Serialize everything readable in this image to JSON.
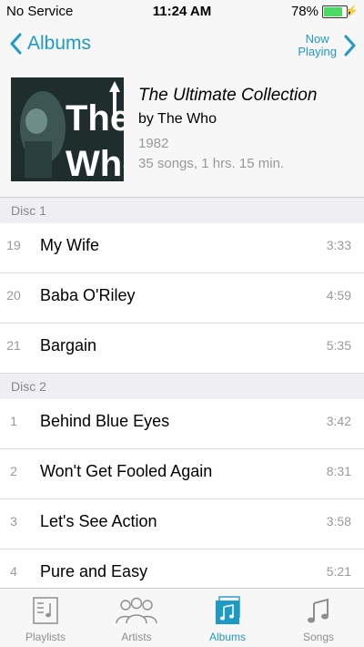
{
  "status": {
    "carrier": "No Service",
    "time": "11:24 AM",
    "battery": "78%",
    "battery_level": 0.78
  },
  "nav": {
    "back_label": "Albums",
    "now_playing": [
      "Now",
      "Playing"
    ]
  },
  "album": {
    "title": "The Ultimate Collection",
    "artist": "by The Who",
    "year": "1982",
    "info": "35 songs, 1 hrs. 15 min.",
    "cover_text": "The Who"
  },
  "discs": [
    {
      "label": "Disc 1",
      "tracks": [
        {
          "num": "19",
          "name": "My Wife",
          "duration": "3:33"
        },
        {
          "num": "20",
          "name": "Baba O'Riley",
          "duration": "4:59"
        },
        {
          "num": "21",
          "name": "Bargain",
          "duration": "5:35"
        }
      ]
    },
    {
      "label": "Disc 2",
      "tracks": [
        {
          "num": "1",
          "name": "Behind Blue Eyes",
          "duration": "3:42"
        },
        {
          "num": "2",
          "name": "Won't Get Fooled Again",
          "duration": "8:31"
        },
        {
          "num": "3",
          "name": "Let's See Action",
          "duration": "3:58"
        },
        {
          "num": "4",
          "name": "Pure and Easy",
          "duration": "5:21"
        }
      ]
    }
  ],
  "tabs": [
    {
      "label": "Playlists",
      "icon": "playlists-icon",
      "active": false
    },
    {
      "label": "Artists",
      "icon": "artists-icon",
      "active": false
    },
    {
      "label": "Albums",
      "icon": "albums-icon",
      "active": true
    },
    {
      "label": "Songs",
      "icon": "songs-icon",
      "active": false
    }
  ],
  "colors": {
    "accent": "#1e9ac6",
    "battery": "#4cd964"
  }
}
